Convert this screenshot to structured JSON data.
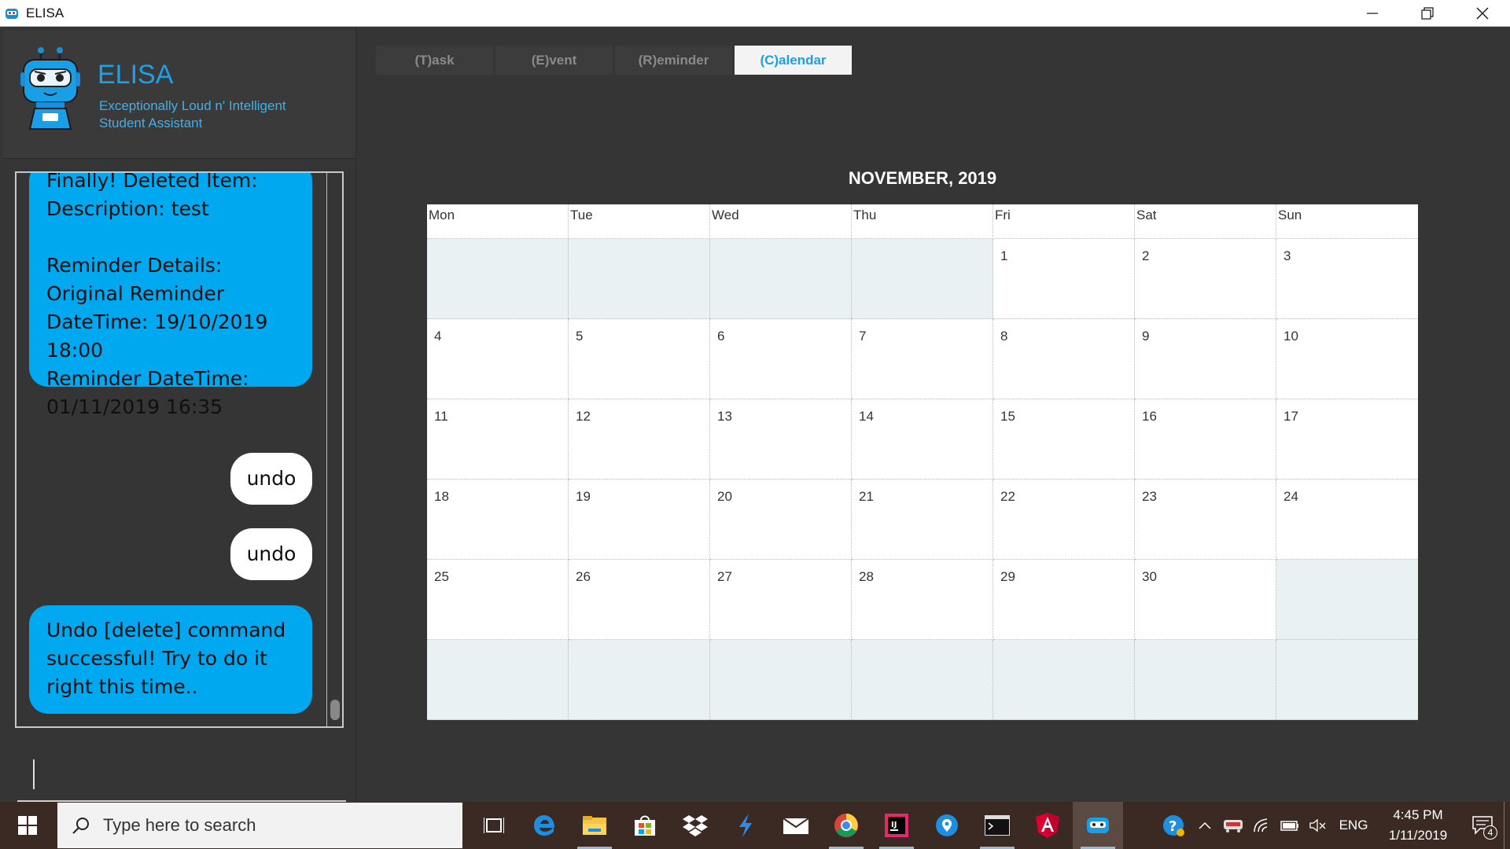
{
  "window": {
    "title": "ELISA"
  },
  "header": {
    "app_name": "ELISA",
    "subtitle_line1": "Exceptionally Loud n' Intelligent",
    "subtitle_line2": "Student Assistant"
  },
  "chat": {
    "messages": [
      {
        "from": "elisa",
        "lines": [
          "Finally! Deleted Item:",
          "Description: test",
          "",
          "Reminder Details:",
          "Original Reminder",
          "DateTime: 19/10/2019",
          "18:00",
          "Reminder DateTime:",
          "01/11/2019 16:35"
        ]
      },
      {
        "from": "user",
        "text": "undo"
      },
      {
        "from": "user",
        "text": "undo"
      },
      {
        "from": "elisa",
        "lines": [
          "Undo [delete] command",
          "successful! Try to do it",
          "right this time.."
        ]
      }
    ]
  },
  "input": {
    "value": "",
    "placeholder": ""
  },
  "tabs": [
    {
      "label": "(T)ask",
      "active": false
    },
    {
      "label": "(E)vent",
      "active": false
    },
    {
      "label": "(R)eminder",
      "active": false
    },
    {
      "label": "(C)alendar",
      "active": true
    }
  ],
  "calendar": {
    "title": "NOVEMBER, 2019",
    "days": [
      "Mon",
      "Tue",
      "Wed",
      "Thu",
      "Fri",
      "Sat",
      "Sun"
    ],
    "weeks": [
      [
        "",
        "",
        "",
        "",
        "1",
        "2",
        "3"
      ],
      [
        "4",
        "5",
        "6",
        "7",
        "8",
        "9",
        "10"
      ],
      [
        "11",
        "12",
        "13",
        "14",
        "15",
        "16",
        "17"
      ],
      [
        "18",
        "19",
        "20",
        "21",
        "22",
        "23",
        "24"
      ],
      [
        "25",
        "26",
        "27",
        "28",
        "29",
        "30",
        ""
      ],
      [
        "",
        "",
        "",
        "",
        "",
        "",
        ""
      ]
    ]
  },
  "taskbar": {
    "search_placeholder": "Type here to search",
    "apps": [
      "task-view-icon",
      "edge-icon",
      "file-explorer-icon",
      "store-icon",
      "dropbox-icon",
      "visual-studio-icon",
      "mail-icon",
      "chrome-icon",
      "intellij-icon",
      "maps-icon",
      "terminal-icon",
      "angular-icon",
      "elisa-app-icon"
    ],
    "tray": {
      "language": "ENG",
      "time": "4:45 PM",
      "date": "1/11/2019",
      "notification_count": "4"
    }
  },
  "colors": {
    "accent": "#1ea0e6",
    "elisa_bubble": "#00a8ef",
    "background": "#353535",
    "empty_cell": "#e9f1f2",
    "taskbar": "#3b2a23"
  }
}
